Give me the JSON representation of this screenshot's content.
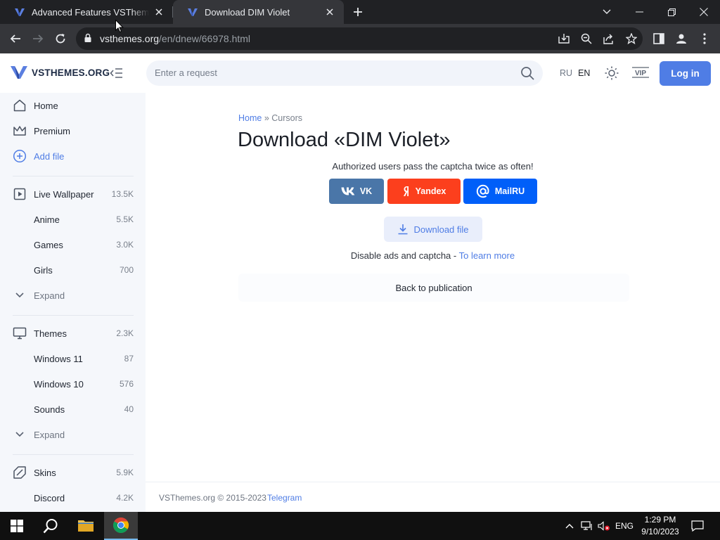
{
  "browser": {
    "tabs": [
      {
        "title": "Advanced Features VSThemes.org",
        "active": false
      },
      {
        "title": "Download DIM Violet",
        "active": true
      }
    ],
    "url_host": "vsthemes.org",
    "url_path": "/en/dnew/66978.html"
  },
  "site": {
    "logo_text": "VSTHEMES.ORG",
    "search_placeholder": "Enter a request",
    "lang_ru": "RU",
    "lang_en": "EN",
    "vip_label": "VIP",
    "login_label": "Log in"
  },
  "sidebar": {
    "top_items": [
      {
        "label": "Home",
        "icon": "home-icon"
      },
      {
        "label": "Premium",
        "icon": "crown-icon"
      },
      {
        "label": "Add file",
        "icon": "plus-circle-icon"
      }
    ],
    "wallpaper": {
      "label": "Live Wallpaper",
      "count": "13.5K"
    },
    "wallpaper_sub": [
      {
        "label": "Anime",
        "count": "5.5K"
      },
      {
        "label": "Games",
        "count": "3.0K"
      },
      {
        "label": "Girls",
        "count": "700"
      }
    ],
    "expand1": "Expand",
    "themes": {
      "label": "Themes",
      "count": "2.3K"
    },
    "themes_sub": [
      {
        "label": "Windows 11",
        "count": "87"
      },
      {
        "label": "Windows 10",
        "count": "576"
      },
      {
        "label": "Sounds",
        "count": "40"
      }
    ],
    "expand2": "Expand",
    "skins": {
      "label": "Skins",
      "count": "5.9K"
    },
    "discord": {
      "label": "Discord",
      "count": "4.2K"
    }
  },
  "main": {
    "breadcrumb_home": "Home",
    "breadcrumb_sep": " » ",
    "breadcrumb_current": "Cursors",
    "title": "Download «DIM Violet»",
    "captcha_note": "Authorized users pass the captcha twice as often!",
    "social": {
      "vk": "VK",
      "yandex": "Yandex",
      "mailru": "MailRU"
    },
    "download_label": "Download file",
    "ads_text": "Disable ads and captcha - ",
    "ads_link": "To learn more",
    "back_label": "Back to publication"
  },
  "footer": {
    "copyright": "VSThemes.org © 2015-2023",
    "telegram": "Telegram"
  },
  "taskbar": {
    "lang": "ENG",
    "time": "1:29 PM",
    "date": "9/10/2023"
  },
  "colors": {
    "accent": "#4f7de5",
    "vk": "#4a76a8",
    "yandex": "#fc3f1d",
    "mailru": "#005ff9"
  }
}
